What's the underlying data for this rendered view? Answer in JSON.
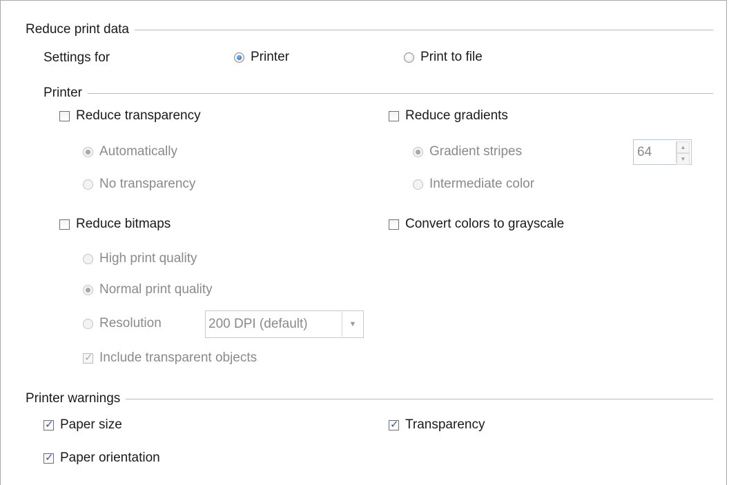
{
  "reduce_print_data": {
    "title": "Reduce print data",
    "settings_for_label": "Settings for",
    "printer_option": "Printer",
    "print_to_file_option": "Print to file"
  },
  "printer_section": {
    "title": "Printer",
    "reduce_transparency": "Reduce transparency",
    "automatically": "Automatically",
    "no_transparency": "No transparency",
    "reduce_gradients": "Reduce gradients",
    "gradient_stripes": "Gradient stripes",
    "gradient_stripes_value": "64",
    "intermediate_color": "Intermediate color",
    "reduce_bitmaps": "Reduce bitmaps",
    "high_print_quality": "High print quality",
    "normal_print_quality": "Normal print quality",
    "resolution": "Resolution",
    "resolution_value": "200 DPI (default)",
    "include_transparent_objects": "Include transparent objects",
    "convert_grayscale": "Convert colors to grayscale"
  },
  "printer_warnings": {
    "title": "Printer warnings",
    "paper_size": "Paper size",
    "transparency": "Transparency",
    "paper_orientation": "Paper orientation"
  },
  "states": {
    "settings_for_selected": "Printer",
    "reduce_transparency_checked": false,
    "reduce_gradients_checked": false,
    "reduce_bitmaps_checked": false,
    "convert_grayscale_checked": false,
    "include_transparent_objects_checked": true,
    "paper_size_checked": true,
    "transparency_checked": true,
    "paper_orientation_checked": true
  },
  "icons": {
    "spin_up": "spin-up-icon",
    "spin_down": "spin-down-icon",
    "dropdown": "chevron-down-icon"
  }
}
